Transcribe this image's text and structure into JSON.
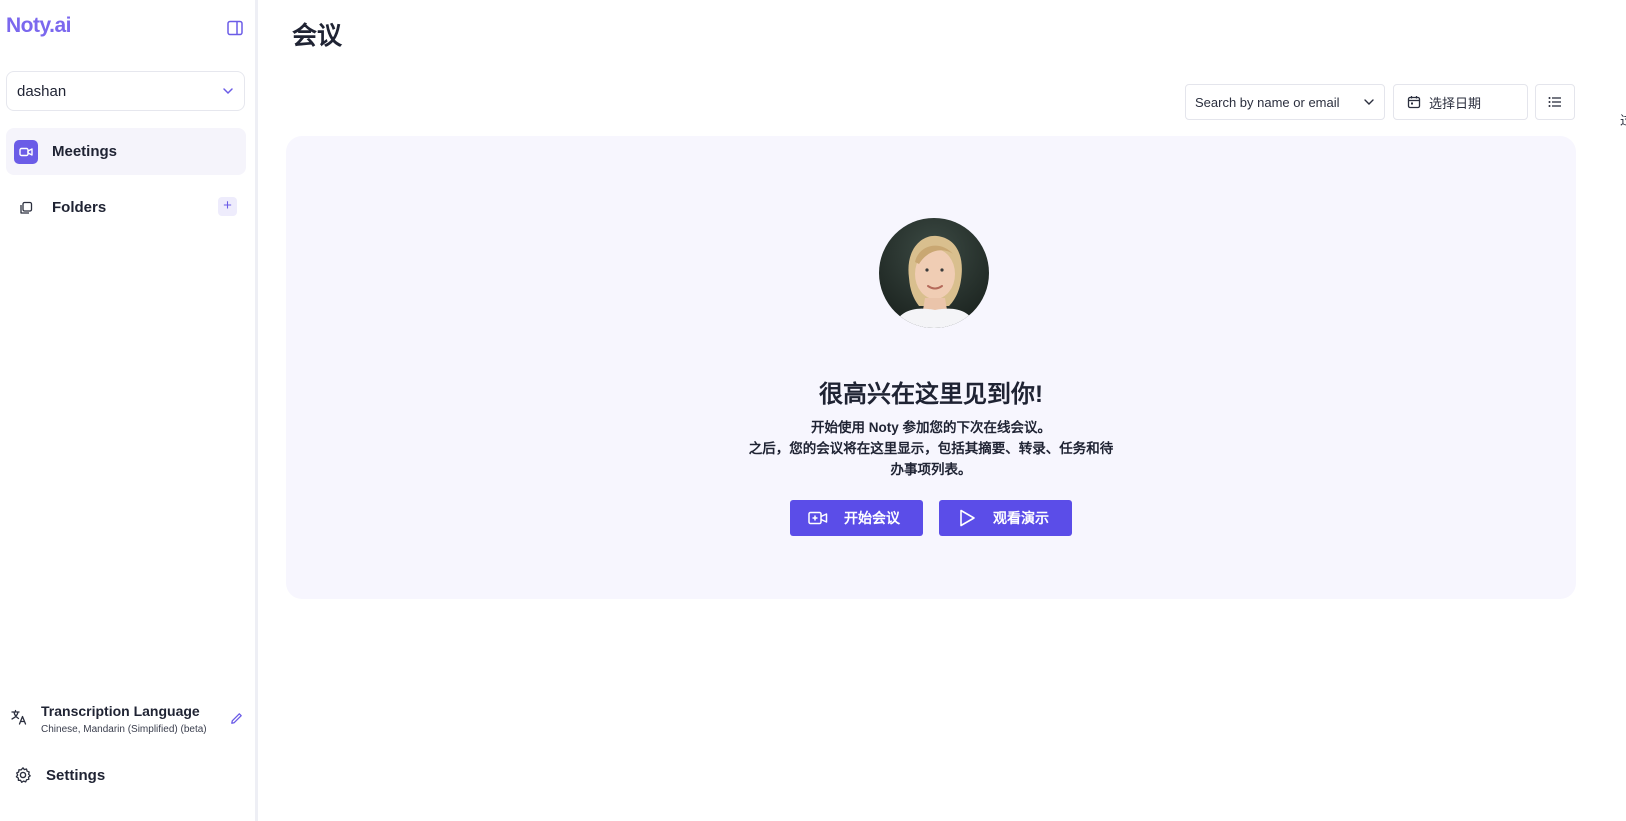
{
  "sidebar": {
    "logo": "Noty.ai",
    "workspace": "dashan",
    "items": [
      {
        "label": "Meetings",
        "icon": "video-camera-icon"
      },
      {
        "label": "Folders",
        "icon": "folders-icon"
      }
    ],
    "add_folder_label": "+",
    "transcription": {
      "title": "Transcription Language",
      "value": "Chinese, Mandarin (Simplified) (beta)"
    },
    "settings_label": "Settings"
  },
  "main": {
    "title": "会议",
    "filters": {
      "search_placeholder": "Search by name or email",
      "date_label": "选择日期"
    },
    "edge_glyph": "过",
    "empty_state": {
      "heading": "很高兴在这里见到你!",
      "line1": "开始使用 Noty 参加您的下次在线会议。",
      "line2": "之后，您的会议将在这里显示，包括其摘要、转录、任务和待",
      "line3": "办事项列表。",
      "start_button": "开始会议",
      "demo_button": "观看演示"
    }
  },
  "colors": {
    "accent": "#5b4de8",
    "logo": "#7b68ee",
    "panel_bg": "#f7f6fe"
  }
}
